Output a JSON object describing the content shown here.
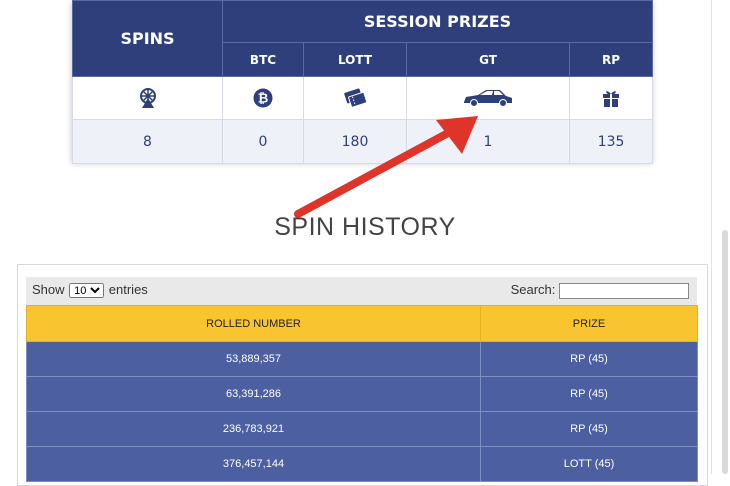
{
  "session_prizes": {
    "spins_header": "SPINS",
    "title": "SESSION PRIZES",
    "columns": [
      "BTC",
      "LOTT",
      "GT",
      "RP"
    ],
    "icons": [
      "wheel-icon",
      "bitcoin-icon",
      "tickets-icon",
      "car-icon",
      "gift-icon"
    ],
    "values": {
      "spins": "8",
      "btc": "0",
      "lott": "180",
      "gt": "1",
      "rp": "135"
    }
  },
  "heading": "SPIN HISTORY",
  "history": {
    "show_label": "Show",
    "entries_value": "10",
    "entries_label": "entries",
    "search_label": "Search:",
    "columns": [
      "ROLLED NUMBER",
      "PRIZE"
    ],
    "rows": [
      {
        "rolled": "53,889,357",
        "prize": "RP (45)"
      },
      {
        "rolled": "63,391,286",
        "prize": "RP (45)"
      },
      {
        "rolled": "236,783,921",
        "prize": "RP (45)"
      },
      {
        "rolled": "376,457,144",
        "prize": "LOTT (45)"
      }
    ]
  },
  "colors": {
    "navy": "#2e3f7c",
    "row_blue": "#4b5fa1",
    "header_yellow": "#f8c531",
    "arrow_red": "#e0342b"
  }
}
